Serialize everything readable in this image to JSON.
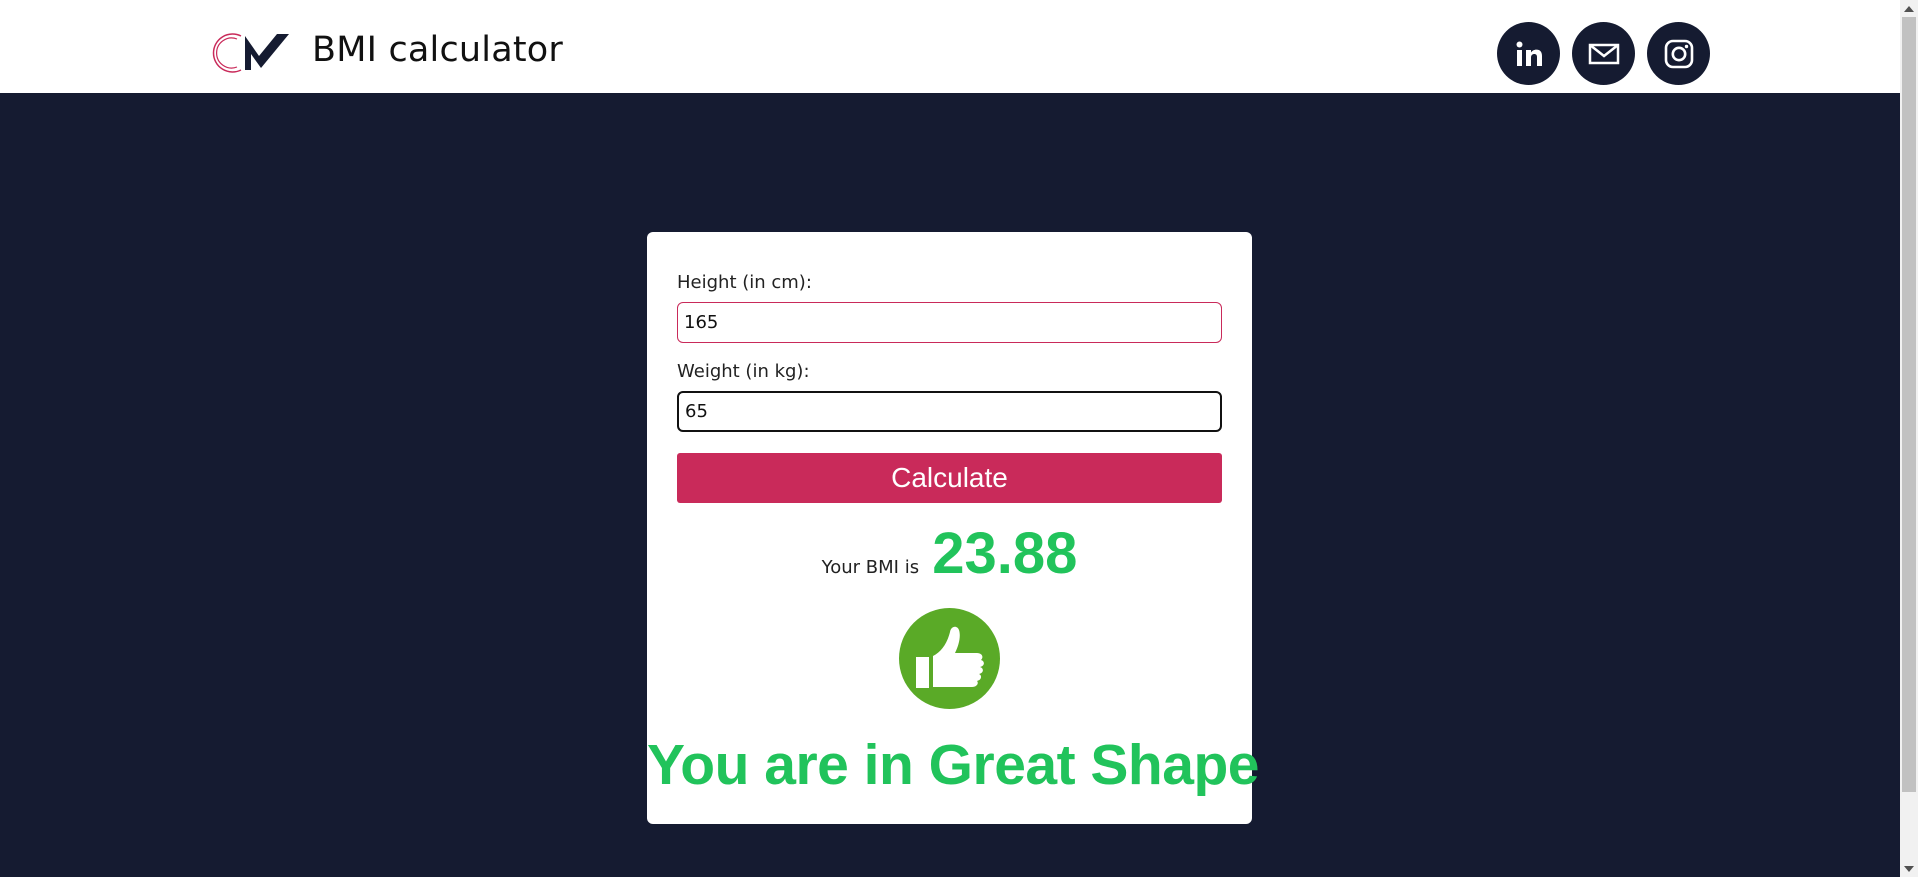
{
  "header": {
    "title": "BMI calculator",
    "logo_icon": "cm-logo",
    "social": [
      {
        "name": "linkedin-icon",
        "glyph": "in"
      },
      {
        "name": "mail-icon"
      },
      {
        "name": "instagram-icon"
      }
    ]
  },
  "form": {
    "height_label": "Height (in cm):",
    "height_value": "165",
    "weight_label": "Weight (in kg):",
    "weight_value": "65",
    "calculate_label": "Calculate"
  },
  "result": {
    "label": "Your BMI is",
    "value": "23.88",
    "icon": "thumbs-up-icon",
    "status": "You are in Great Shape"
  },
  "colors": {
    "navy": "#151b31",
    "accent": "#c92a5a",
    "success": "#21c35b",
    "thumb": "#5aaa27"
  }
}
